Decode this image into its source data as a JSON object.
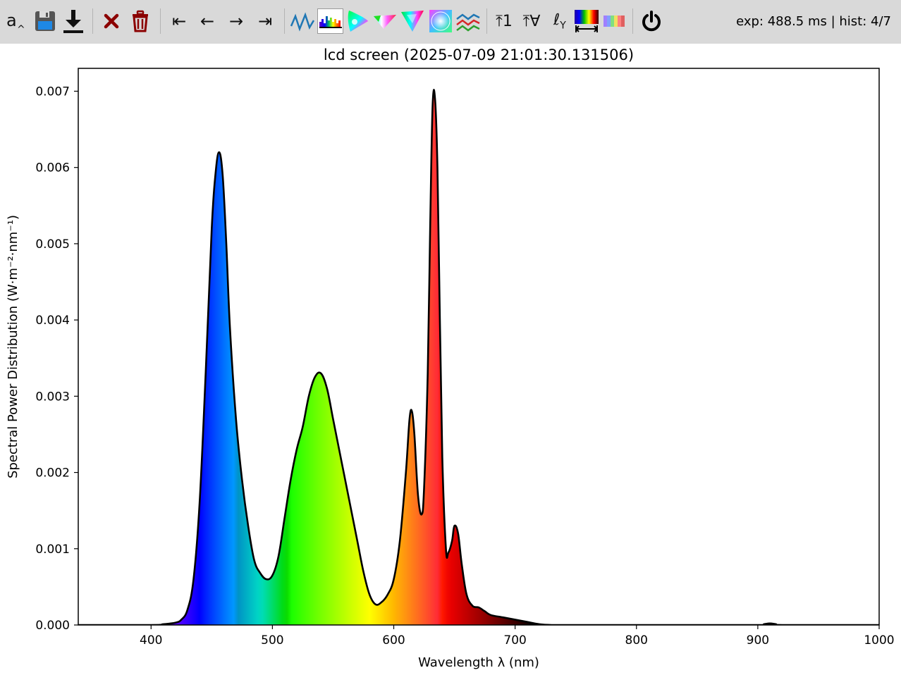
{
  "toolbar": {
    "buttons": [
      {
        "name": "auto-exposure",
        "icon": "auto-exposure-icon"
      },
      {
        "name": "save",
        "icon": "floppy-disk-icon"
      },
      {
        "name": "download",
        "icon": "download-icon"
      },
      {
        "name": "clear",
        "icon": "close-icon"
      },
      {
        "name": "delete",
        "icon": "trash-icon"
      },
      {
        "name": "first",
        "icon": "arrow-to-start-icon",
        "glyph": "⇤"
      },
      {
        "name": "previous",
        "icon": "arrow-left-icon",
        "glyph": "←"
      },
      {
        "name": "next",
        "icon": "arrow-right-icon",
        "glyph": "→"
      },
      {
        "name": "last",
        "icon": "arrow-to-end-icon",
        "glyph": "⇥"
      },
      {
        "name": "spectrum-line-view",
        "icon": "spectrum-line-icon"
      },
      {
        "name": "spectrum-colored-view",
        "icon": "spectrum-colored-icon"
      },
      {
        "name": "cie1931-view",
        "icon": "cie-1931-icon"
      },
      {
        "name": "cie1960-view",
        "icon": "cie-1960-icon"
      },
      {
        "name": "cie1976-view",
        "icon": "cie-1976-icon"
      },
      {
        "name": "color-wheel-view",
        "icon": "color-wheel-icon"
      },
      {
        "name": "compare-view",
        "icon": "multi-line-icon"
      },
      {
        "name": "normalize-one",
        "icon": "normalize-one-icon",
        "glyph": "⤒1"
      },
      {
        "name": "normalize-all",
        "icon": "normalize-all-icon",
        "glyph": "⤒∀"
      },
      {
        "name": "luminance",
        "icon": "luminance-icon",
        "glyph": "ℓ",
        "sub": "Y"
      },
      {
        "name": "wavelength-range",
        "icon": "wavelength-range-icon"
      },
      {
        "name": "color-swatches",
        "icon": "color-swatches-icon"
      },
      {
        "name": "power",
        "icon": "power-icon"
      }
    ],
    "status": "exp: 488.5 ms | hist: 4/7"
  },
  "chart_data": {
    "type": "area",
    "title": "lcd screen (2025-07-09 21:01:30.131506)",
    "xlabel": "Wavelength λ (nm)",
    "ylabel": "Spectral Power Distribution (W·m⁻²·nm⁻¹)",
    "xlim": [
      340,
      1000
    ],
    "ylim": [
      0,
      0.0073
    ],
    "xticks": [
      400,
      500,
      600,
      700,
      800,
      900,
      1000
    ],
    "yticks": [
      0.0,
      0.001,
      0.002,
      0.003,
      0.004,
      0.005,
      0.006,
      0.007
    ],
    "ytick_labels": [
      "0.000",
      "0.001",
      "0.002",
      "0.003",
      "0.004",
      "0.005",
      "0.006",
      "0.007"
    ],
    "fill": "spectral colors by wavelength",
    "line_color": "#000000",
    "grid": false,
    "x": [
      340,
      400,
      410,
      420,
      425,
      430,
      435,
      440,
      445,
      450,
      453,
      456,
      459,
      462,
      465,
      470,
      475,
      480,
      485,
      490,
      495,
      500,
      505,
      510,
      515,
      520,
      525,
      530,
      535,
      540,
      545,
      550,
      555,
      560,
      565,
      570,
      575,
      580,
      585,
      590,
      595,
      600,
      605,
      610,
      613,
      615,
      617,
      620,
      623,
      625,
      628,
      630,
      632,
      634,
      636,
      638,
      640,
      643,
      645,
      648,
      650,
      653,
      656,
      660,
      665,
      670,
      675,
      680,
      690,
      700,
      710,
      720,
      730,
      750,
      800,
      900,
      905,
      910,
      915,
      920,
      1000
    ],
    "y": [
      0,
      0,
      1e-05,
      3e-05,
      7e-05,
      0.0002,
      0.0006,
      0.0016,
      0.0033,
      0.0052,
      0.0059,
      0.0062,
      0.0059,
      0.005,
      0.0039,
      0.0027,
      0.0019,
      0.0013,
      0.00085,
      0.00068,
      0.0006,
      0.00065,
      0.0009,
      0.0014,
      0.0019,
      0.0023,
      0.0026,
      0.003,
      0.00325,
      0.0033,
      0.0031,
      0.0027,
      0.0023,
      0.0019,
      0.0015,
      0.0011,
      0.0007,
      0.0004,
      0.00027,
      0.0003,
      0.0004,
      0.0006,
      0.0011,
      0.002,
      0.0027,
      0.0028,
      0.0025,
      0.0017,
      0.00145,
      0.0018,
      0.0033,
      0.0052,
      0.0068,
      0.0069,
      0.006,
      0.004,
      0.0022,
      0.001,
      0.00095,
      0.0011,
      0.0013,
      0.0012,
      0.0008,
      0.0004,
      0.00025,
      0.00023,
      0.00018,
      0.00013,
      0.0001,
      7e-05,
      4e-05,
      1e-05,
      0,
      0,
      0,
      0,
      1e-05,
      2e-05,
      1e-05,
      0,
      0
    ]
  }
}
